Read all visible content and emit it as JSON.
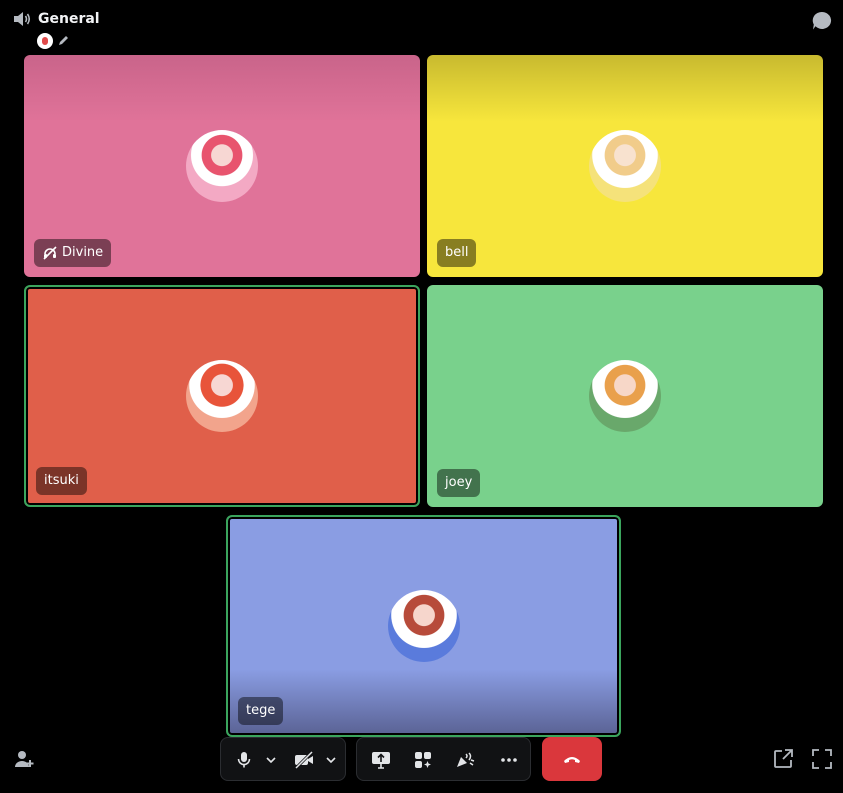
{
  "channel": {
    "name": "General",
    "icon": "speaker-icon"
  },
  "participants": [
    {
      "name": "Divine",
      "tile_color": "#e07399",
      "status_icon": "muted-deafened-icon",
      "speaking": false
    },
    {
      "name": "bell",
      "tile_color": "#f7e63c",
      "status_icon": "",
      "speaking": false
    },
    {
      "name": "itsuki",
      "tile_color": "#e05f4a",
      "status_icon": "",
      "speaking": true
    },
    {
      "name": "joey",
      "tile_color": "#79d18c",
      "status_icon": "",
      "speaking": false
    },
    {
      "name": "tege",
      "tile_color": "#8a9de3",
      "status_icon": "",
      "speaking": true
    }
  ],
  "controls": {
    "mic": "microphone-icon",
    "mic_options": "chevron-down-icon",
    "camera": "camera-off-icon",
    "camera_options": "chevron-down-icon",
    "screen_share": "screen-share-icon",
    "activities": "activities-icon",
    "soundboard": "soundboard-icon",
    "more": "more-icon",
    "disconnect": "disconnect-icon"
  },
  "corners": {
    "invite": "add-user-icon",
    "popout": "popout-icon",
    "fullscreen": "fullscreen-icon",
    "chat": "chat-icon"
  },
  "colors": {
    "background": "#000000",
    "speaking_border": "#3ba55d",
    "end_call": "#da373c"
  }
}
